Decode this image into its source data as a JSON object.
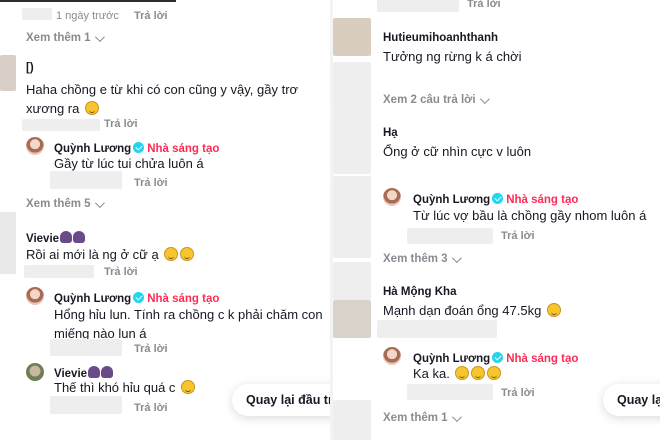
{
  "left": {
    "top_meta": {
      "time": "1 ngày trước",
      "reply": "Trả lời"
    },
    "viewmore_1": "Xem thêm 1",
    "c1": {
      "username": "[)",
      "text_line1": "Haha chồng e từ khi có con cũng y vậy, gầy trơ",
      "text_line2": "xương ra",
      "emoji": "rolling-laughing",
      "reply": "Trả lời"
    },
    "r1": {
      "username": "Quỳnh Lương",
      "badge": "Nhà sáng tạo",
      "text": "Gầy từ lúc tui chửa luôn á",
      "reply": "Trả lời"
    },
    "viewmore_5": "Xem thêm 5",
    "c2": {
      "username": "Vievie",
      "text": "Rồi ai mới là ng ở cữ ạ",
      "emoji": "laughing",
      "reply": "Trả lời"
    },
    "r2": {
      "username": "Quỳnh Lương",
      "badge": "Nhà sáng tạo",
      "text_line1": "Hổng hỉu lun. Tính ra chồng c k phải chăm con",
      "text_line2": "miếng nào lun á",
      "reply": "Trả lời"
    },
    "r3": {
      "username": "Vievie",
      "text": "Thế thì khó hỉu quá c",
      "emoji": "laughing",
      "reply": "Trả lời"
    },
    "back_to_top": "Quay lại đầu tr"
  },
  "right": {
    "top_meta": {
      "reply": "Trả lời"
    },
    "c1": {
      "username": "Hutieumihoanhthanh",
      "text": "Tưởng ng rừng k á chời"
    },
    "viewmore_2": "Xem 2 câu trả lời",
    "c2": {
      "username": "Hạ",
      "text": "Ổng ở cữ nhìn cực v luôn"
    },
    "r1": {
      "username": "Quỳnh Lương",
      "badge": "Nhà sáng tạo",
      "text": "Từ lúc vợ bầu là chồng gầy nhom luôn á",
      "reply": "Trả lời"
    },
    "viewmore_3": "Xem thêm 3",
    "c3": {
      "username": "Hà Mộng Kha",
      "text": "Mạnh dạn đoán ổng 47.5kg",
      "emoji": "grinning"
    },
    "r2": {
      "username": "Quỳnh Lương",
      "badge": "Nhà sáng tạo",
      "text": "Ka ka.",
      "emoji": "laughing",
      "reply": "Trả lời"
    },
    "viewmore_1": "Xem thêm 1",
    "back_to_top": "Quay lại"
  },
  "colors": {
    "accent": "#fe2c55",
    "verified": "#20d5ec",
    "muted": "#8a8b91",
    "text": "#161823"
  },
  "icons": {
    "verified": "verified-badge-icon",
    "chevron": "chevron-down-icon"
  }
}
